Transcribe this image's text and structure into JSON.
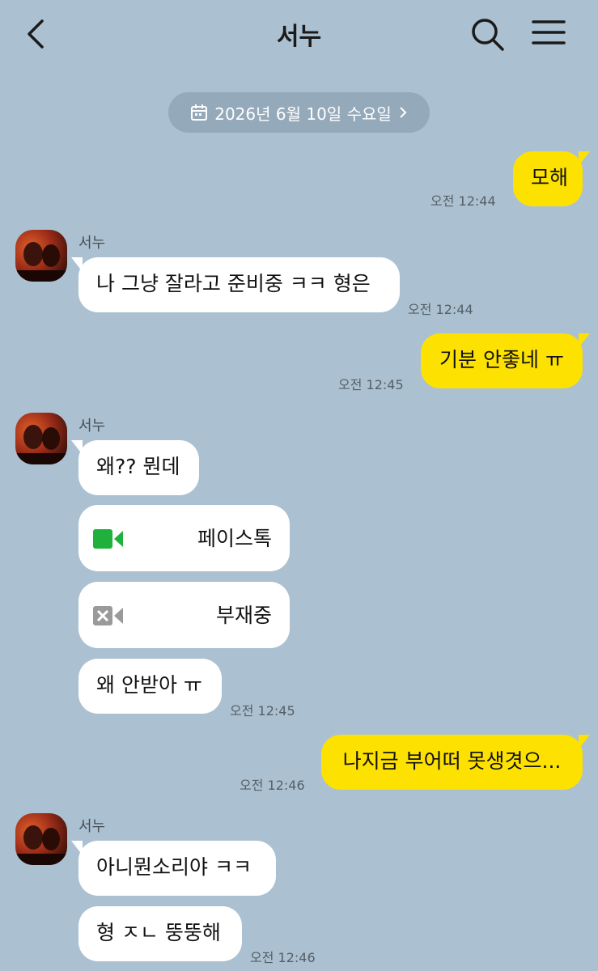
{
  "header": {
    "title": "서누"
  },
  "date_divider": {
    "text": "2026년 6월 10일 수요일"
  },
  "messages": {
    "m1": {
      "text": "모해",
      "time": "오전 12:44"
    },
    "g1": {
      "sender": "서누",
      "m1": {
        "text": "나 그냥 잘라고 준비중 ㅋㅋ 형은",
        "time": "오전 12:44"
      }
    },
    "m2": {
      "text": "기분 안좋네 ㅠ",
      "time": "오전 12:45"
    },
    "g2": {
      "sender": "서누",
      "m1": {
        "text": "왜?? 뭔데"
      },
      "call1": {
        "label": "페이스톡",
        "icon": "facetime-video-icon",
        "color": "#1fb13b"
      },
      "call2": {
        "label": "부재중",
        "icon": "missed-video-call-icon",
        "color": "#9a9a9a"
      },
      "m2": {
        "text": "왜 안받아 ㅠ",
        "time": "오전 12:45"
      }
    },
    "m3": {
      "text": "나지금 부어떠 못생겻으...",
      "time": "오전 12:46"
    },
    "g3": {
      "sender": "서누",
      "m1": {
        "text": "아니뭔소리야 ㅋㅋ"
      },
      "m2": {
        "text": "형 ㅈㄴ 뚱뚱해",
        "time": "오전 12:46"
      }
    }
  },
  "colors": {
    "background": "#abc1d1",
    "outgoing": "#fde100",
    "incoming": "#ffffff"
  }
}
